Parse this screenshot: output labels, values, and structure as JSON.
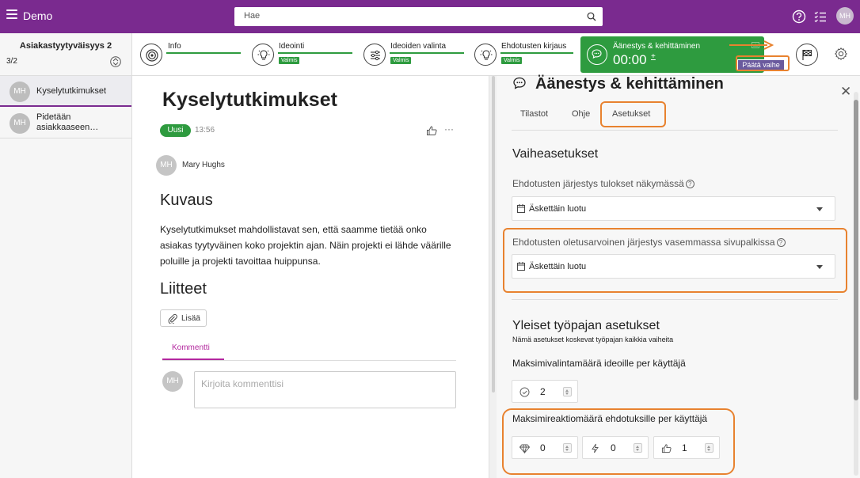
{
  "app": {
    "title": "Demo"
  },
  "search": {
    "placeholder": "Hae"
  },
  "user": {
    "initials": "MH"
  },
  "sidebar": {
    "title": "Asiakastyytyväisyys 2",
    "count": "3/2",
    "items": [
      {
        "initials": "MH",
        "label": "Kyselytutkimukset",
        "active": true
      },
      {
        "initials": "MH",
        "label": "Pidetään asiakkaaseen…",
        "active": false
      }
    ]
  },
  "phases": [
    {
      "label": "Info",
      "badge": "",
      "icon": "target-icon"
    },
    {
      "label": "Ideointi",
      "badge": "Valmis",
      "icon": "lightbulb-icon"
    },
    {
      "label": "Ideoiden valinta",
      "badge": "Valmis",
      "icon": "sliders-icon"
    },
    {
      "label": "Ehdotusten kirjaus",
      "badge": "Valmis",
      "icon": "lightbulb-icon"
    }
  ],
  "active_phase": {
    "label": "Äänestys & kehittäminen",
    "timer": "00:00",
    "plus": "+",
    "end_button": "Päätä vaihe"
  },
  "idea": {
    "title": "Kyselytutkimukset",
    "status": "Uusi",
    "time": "13:56",
    "more": "···",
    "author_initials": "MH",
    "author": "Mary Hughs",
    "description_heading": "Kuvaus",
    "description": "Kyselytutkimukset mahdollistavat sen, että saamme tietää onko asiakas tyytyväinen koko projektin ajan. Näin projekti ei lähde väärille poluille ja projekti tavoittaa huippunsa.",
    "attachments_heading": "Liitteet",
    "add_label": "Lisää",
    "comment_tab": "Kommentti",
    "comment_avatar": "MH",
    "comment_placeholder": "Kirjoita kommenttisi"
  },
  "panel": {
    "title": "Äänestys & kehittäminen",
    "tabs": [
      "Tilastot",
      "Ohje",
      "Asetukset"
    ],
    "phase_settings_heading": "Vaiheasetukset",
    "order_label": "Ehdotusten järjestys tulokset näkymässä",
    "order_value": "Äskettäin luotu",
    "default_order_label": "Ehdotusten oletusarvoinen järjestys vasemmassa sivupalkissa",
    "default_order_value": "Äskettäin luotu",
    "general_heading": "Yleiset työpajan asetukset",
    "general_sub": "Nämä asetukset koskevat työpajan kaikkia vaiheita",
    "max_selections_label": "Maksimivalintamäärä ideoille per käyttäjä",
    "max_selections_value": "2",
    "max_reactions_label": "Maksimireaktiomäärä ehdotuksille per käyttäjä",
    "reactions": [
      {
        "icon": "diamond-icon",
        "value": "0"
      },
      {
        "icon": "lightning-icon",
        "value": "0"
      },
      {
        "icon": "thumbs-up-icon",
        "value": "1"
      }
    ]
  },
  "colors": {
    "brand": "#7a2a8f",
    "active_phase": "#2e9b3f",
    "highlight": "#e8822f"
  }
}
